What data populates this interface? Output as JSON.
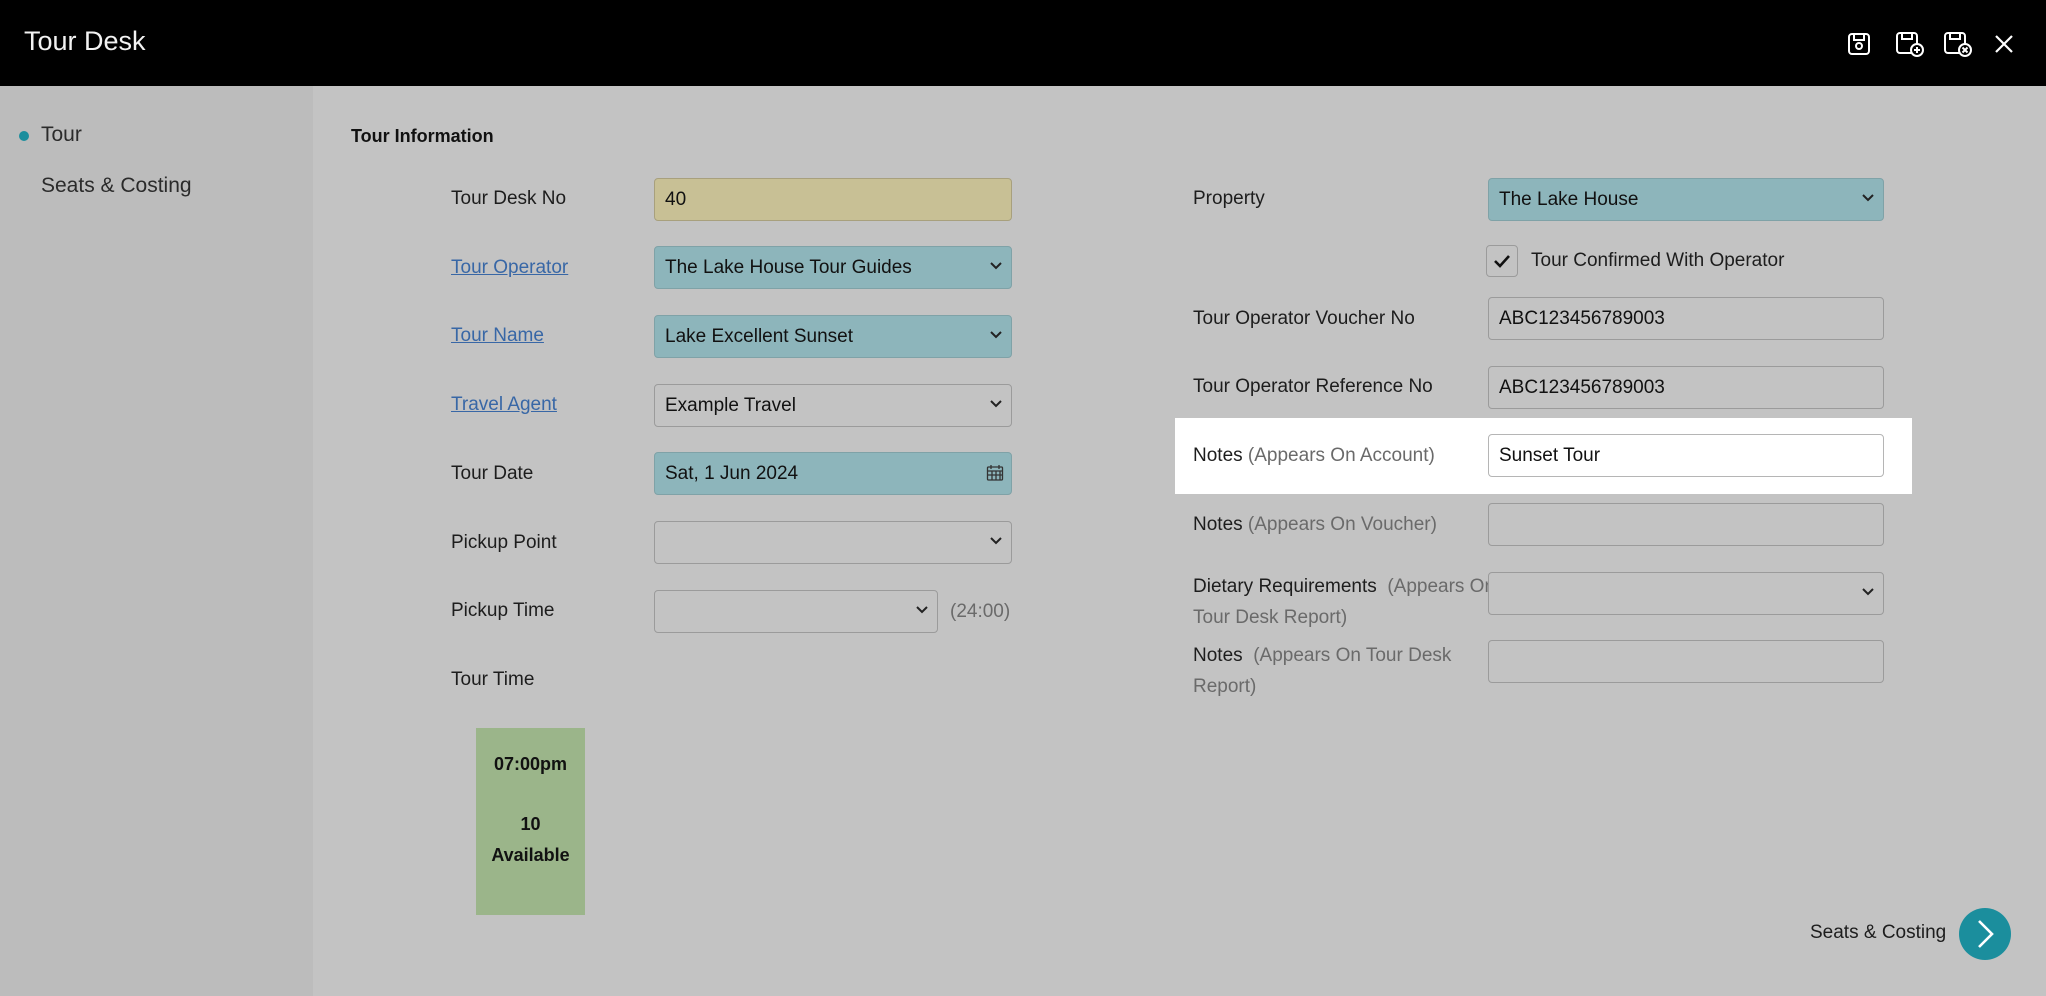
{
  "header": {
    "title": "Tour Desk",
    "icons": [
      "save-icon",
      "save-and-new-icon",
      "save-and-close-icon",
      "close-icon"
    ]
  },
  "sidebar": {
    "items": [
      {
        "label": "Tour",
        "active": true
      },
      {
        "label": "Seats & Costing",
        "active": false
      }
    ]
  },
  "section": {
    "title": "Tour Information"
  },
  "left_form": {
    "tour_desk_no": {
      "label": "Tour Desk No",
      "value": "40"
    },
    "tour_operator": {
      "label": "Tour Operator",
      "value": "The Lake House Tour Guides"
    },
    "tour_name": {
      "label": "Tour Name",
      "value": "Lake Excellent Sunset"
    },
    "travel_agent": {
      "label": "Travel Agent",
      "value": "Example Travel"
    },
    "tour_date": {
      "label": "Tour Date",
      "value": "Sat, 1 Jun 2024"
    },
    "pickup_point": {
      "label": "Pickup Point",
      "value": ""
    },
    "pickup_time": {
      "label": "Pickup Time",
      "value": "",
      "format_hint": "(24:00)"
    },
    "tour_time": {
      "label": "Tour Time"
    }
  },
  "tour_slot": {
    "time": "07:00pm",
    "count": "10",
    "status": "Available"
  },
  "right_form": {
    "property": {
      "label": "Property",
      "value": "The Lake House"
    },
    "confirmed": {
      "label": "Tour Confirmed With Operator",
      "checked": true
    },
    "voucher_no": {
      "label": "Tour Operator Voucher No",
      "value": "ABC123456789003"
    },
    "reference_no": {
      "label": "Tour Operator Reference No",
      "value": "ABC123456789003"
    },
    "notes_account": {
      "label": "Notes",
      "hint": "(Appears On Account)",
      "value": "Sunset Tour"
    },
    "notes_voucher": {
      "label": "Notes",
      "hint": "(Appears On Voucher)",
      "value": ""
    },
    "dietary": {
      "label": "Dietary Requirements",
      "hint_line1": "(Appears On",
      "hint_line2": "Tour Desk Report)",
      "value": ""
    },
    "notes_report": {
      "label": "Notes",
      "hint_line1": "(Appears On Tour Desk",
      "hint_line2": "Report)",
      "value": ""
    }
  },
  "footer": {
    "next_label": "Seats & Costing"
  },
  "colors": {
    "accent": "#1b8e9d",
    "header_bg": "#000000",
    "slot_bg": "#9bb58a"
  }
}
